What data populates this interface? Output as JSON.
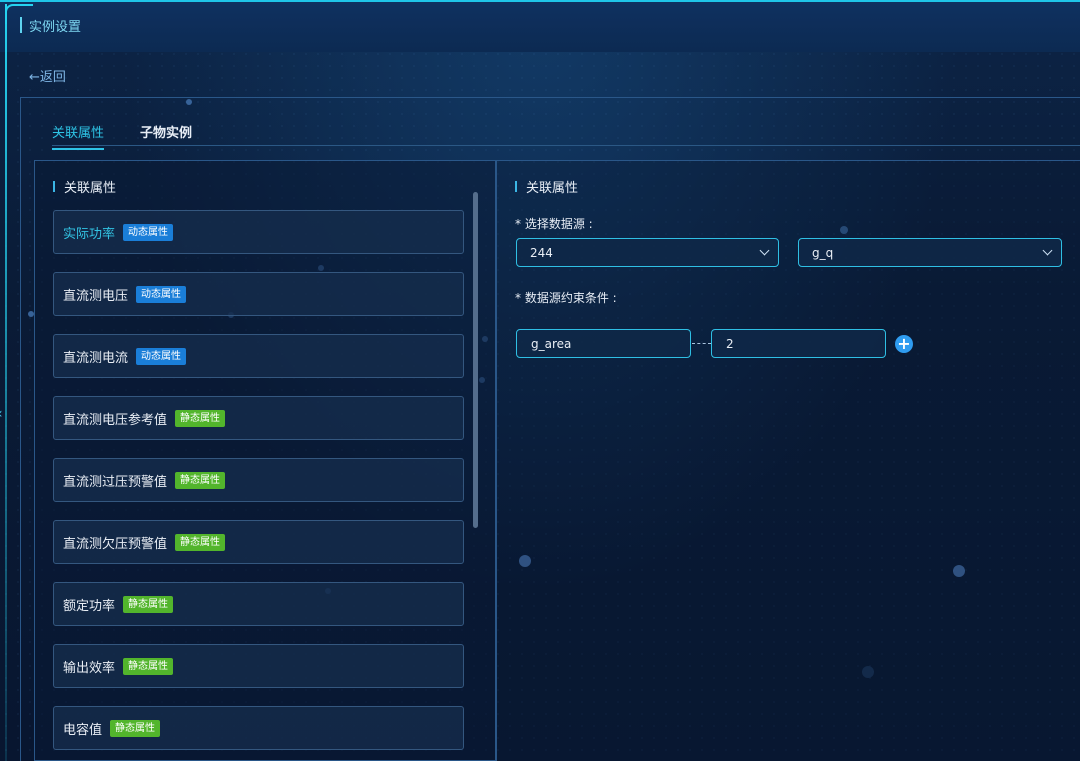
{
  "header": {
    "title": "实例设置"
  },
  "nav": {
    "back": "←返回"
  },
  "tabs": [
    {
      "label": "关联属性",
      "active": true
    },
    {
      "label": "子物实例",
      "active": false
    }
  ],
  "left_panel": {
    "title": "关联属性",
    "items": [
      {
        "name": "实际功率",
        "badge": "动态属性",
        "type": "dynamic",
        "active": true
      },
      {
        "name": "直流测电压",
        "badge": "动态属性",
        "type": "dynamic",
        "active": false
      },
      {
        "name": "直流测电流",
        "badge": "动态属性",
        "type": "dynamic",
        "active": false
      },
      {
        "name": "直流测电压参考值",
        "badge": "静态属性",
        "type": "static",
        "active": false
      },
      {
        "name": "直流测过压预警值",
        "badge": "静态属性",
        "type": "static",
        "active": false
      },
      {
        "name": "直流测欠压预警值",
        "badge": "静态属性",
        "type": "static",
        "active": false
      },
      {
        "name": "额定功率",
        "badge": "静态属性",
        "type": "static",
        "active": false
      },
      {
        "name": "输出效率",
        "badge": "静态属性",
        "type": "static",
        "active": false
      },
      {
        "name": "电容值",
        "badge": "静态属性",
        "type": "static",
        "active": false
      }
    ]
  },
  "right_panel": {
    "title": "关联属性",
    "datasource_label": "* 选择数据源 :",
    "datasource_value": "244",
    "datasource_field": "g_q",
    "constraint_label": "* 数据源约束条件 :",
    "constraint_key": "g_area",
    "constraint_value": "2",
    "add_symbol": "+"
  },
  "colors": {
    "accent": "#2ec4e6",
    "dynamic_badge": "#1a7ed8",
    "static_badge": "#52b52c",
    "background": "#0a1a33"
  }
}
